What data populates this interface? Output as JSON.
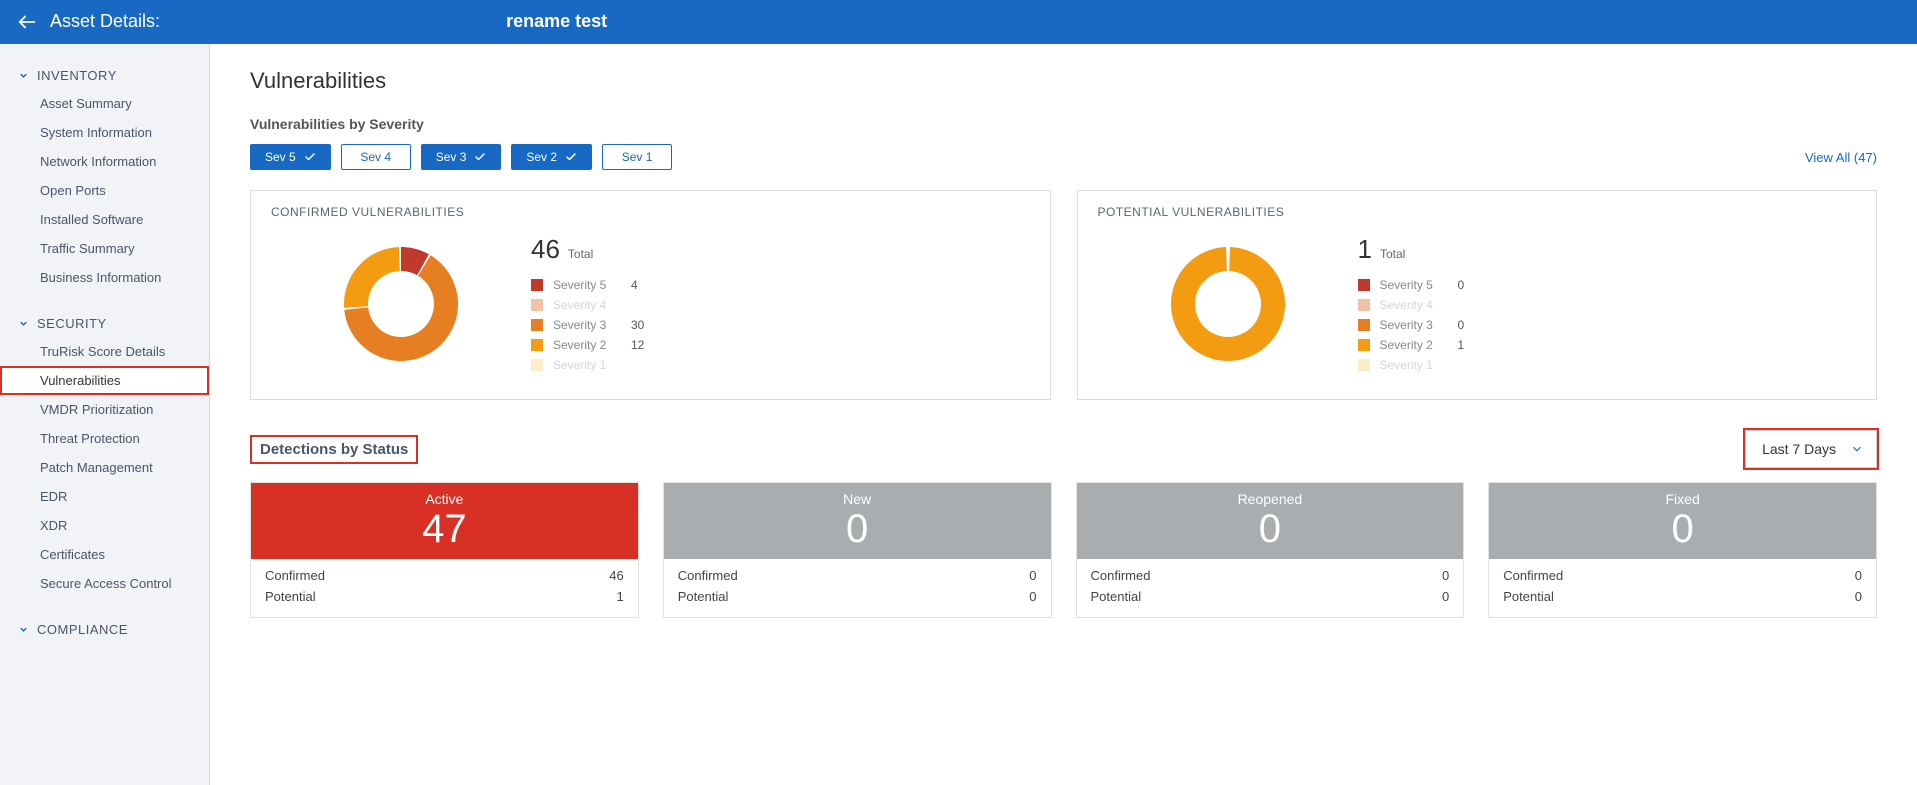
{
  "header": {
    "title_prefix": "Asset Details:",
    "title_suffix": "rename test"
  },
  "sidebar": {
    "groups": [
      {
        "label": "INVENTORY",
        "items": [
          {
            "label": "Asset Summary"
          },
          {
            "label": "System Information"
          },
          {
            "label": "Network Information"
          },
          {
            "label": "Open Ports"
          },
          {
            "label": "Installed Software"
          },
          {
            "label": "Traffic Summary"
          },
          {
            "label": "Business Information"
          }
        ]
      },
      {
        "label": "SECURITY",
        "items": [
          {
            "label": "TruRisk Score Details"
          },
          {
            "label": "Vulnerabilities",
            "active": true,
            "highlight": true
          },
          {
            "label": "VMDR Prioritization"
          },
          {
            "label": "Threat Protection"
          },
          {
            "label": "Patch Management"
          },
          {
            "label": "EDR"
          },
          {
            "label": "XDR"
          },
          {
            "label": "Certificates"
          },
          {
            "label": "Secure Access Control"
          }
        ]
      },
      {
        "label": "COMPLIANCE",
        "items": []
      }
    ]
  },
  "page": {
    "title": "Vulnerabilities",
    "severity_section_label": "Vulnerabilities by Severity",
    "view_all": {
      "label": "View All",
      "count": 47
    },
    "sev_buttons": [
      {
        "label": "Sev 5",
        "selected": true
      },
      {
        "label": "Sev 4",
        "selected": false
      },
      {
        "label": "Sev 3",
        "selected": true
      },
      {
        "label": "Sev 2",
        "selected": true
      },
      {
        "label": "Sev 1",
        "selected": false
      }
    ],
    "total_label": "Total",
    "sev_legend_labels": [
      "Severity 5",
      "Severity 4",
      "Severity 3",
      "Severity 2",
      "Severity 1"
    ],
    "confirmed": {
      "title": "CONFIRMED VULNERABILITIES",
      "total": 46,
      "values": {
        "sev5": "4",
        "sev4": "",
        "sev3": "30",
        "sev2": "12",
        "sev1": ""
      }
    },
    "potential": {
      "title": "POTENTIAL VULNERABILITIES",
      "total": 1,
      "values": {
        "sev5": "0",
        "sev4": "",
        "sev3": "0",
        "sev2": "1",
        "sev1": ""
      }
    },
    "detections": {
      "title": "Detections by Status",
      "range": "Last 7 Days",
      "row_labels": {
        "confirmed": "Confirmed",
        "potential": "Potential"
      },
      "cards": [
        {
          "name": "Active",
          "count": 47,
          "confirmed": 46,
          "potential": 1,
          "tone": "active-red"
        },
        {
          "name": "New",
          "count": 0,
          "confirmed": 0,
          "potential": 0,
          "tone": "grey"
        },
        {
          "name": "Reopened",
          "count": 0,
          "confirmed": 0,
          "potential": 0,
          "tone": "grey"
        },
        {
          "name": "Fixed",
          "count": 0,
          "confirmed": 0,
          "potential": 0,
          "tone": "grey"
        }
      ]
    }
  },
  "colors": {
    "sev5": "#c0392b",
    "sev4": "#d35400",
    "sev3": "#e67e22",
    "sev2": "#f39c12",
    "sev1": "#f7ca60"
  },
  "chart_data": [
    {
      "type": "pie",
      "title": "CONFIRMED VULNERABILITIES",
      "total": 46,
      "series": [
        {
          "name": "Severity 5",
          "value": 4,
          "color": "#c0392b"
        },
        {
          "name": "Severity 3",
          "value": 30,
          "color": "#e67e22"
        },
        {
          "name": "Severity 2",
          "value": 12,
          "color": "#f39c12"
        }
      ]
    },
    {
      "type": "pie",
      "title": "POTENTIAL VULNERABILITIES",
      "total": 1,
      "series": [
        {
          "name": "Severity 5",
          "value": 0,
          "color": "#c0392b"
        },
        {
          "name": "Severity 3",
          "value": 0,
          "color": "#e67e22"
        },
        {
          "name": "Severity 2",
          "value": 1,
          "color": "#f39c12"
        }
      ]
    }
  ]
}
